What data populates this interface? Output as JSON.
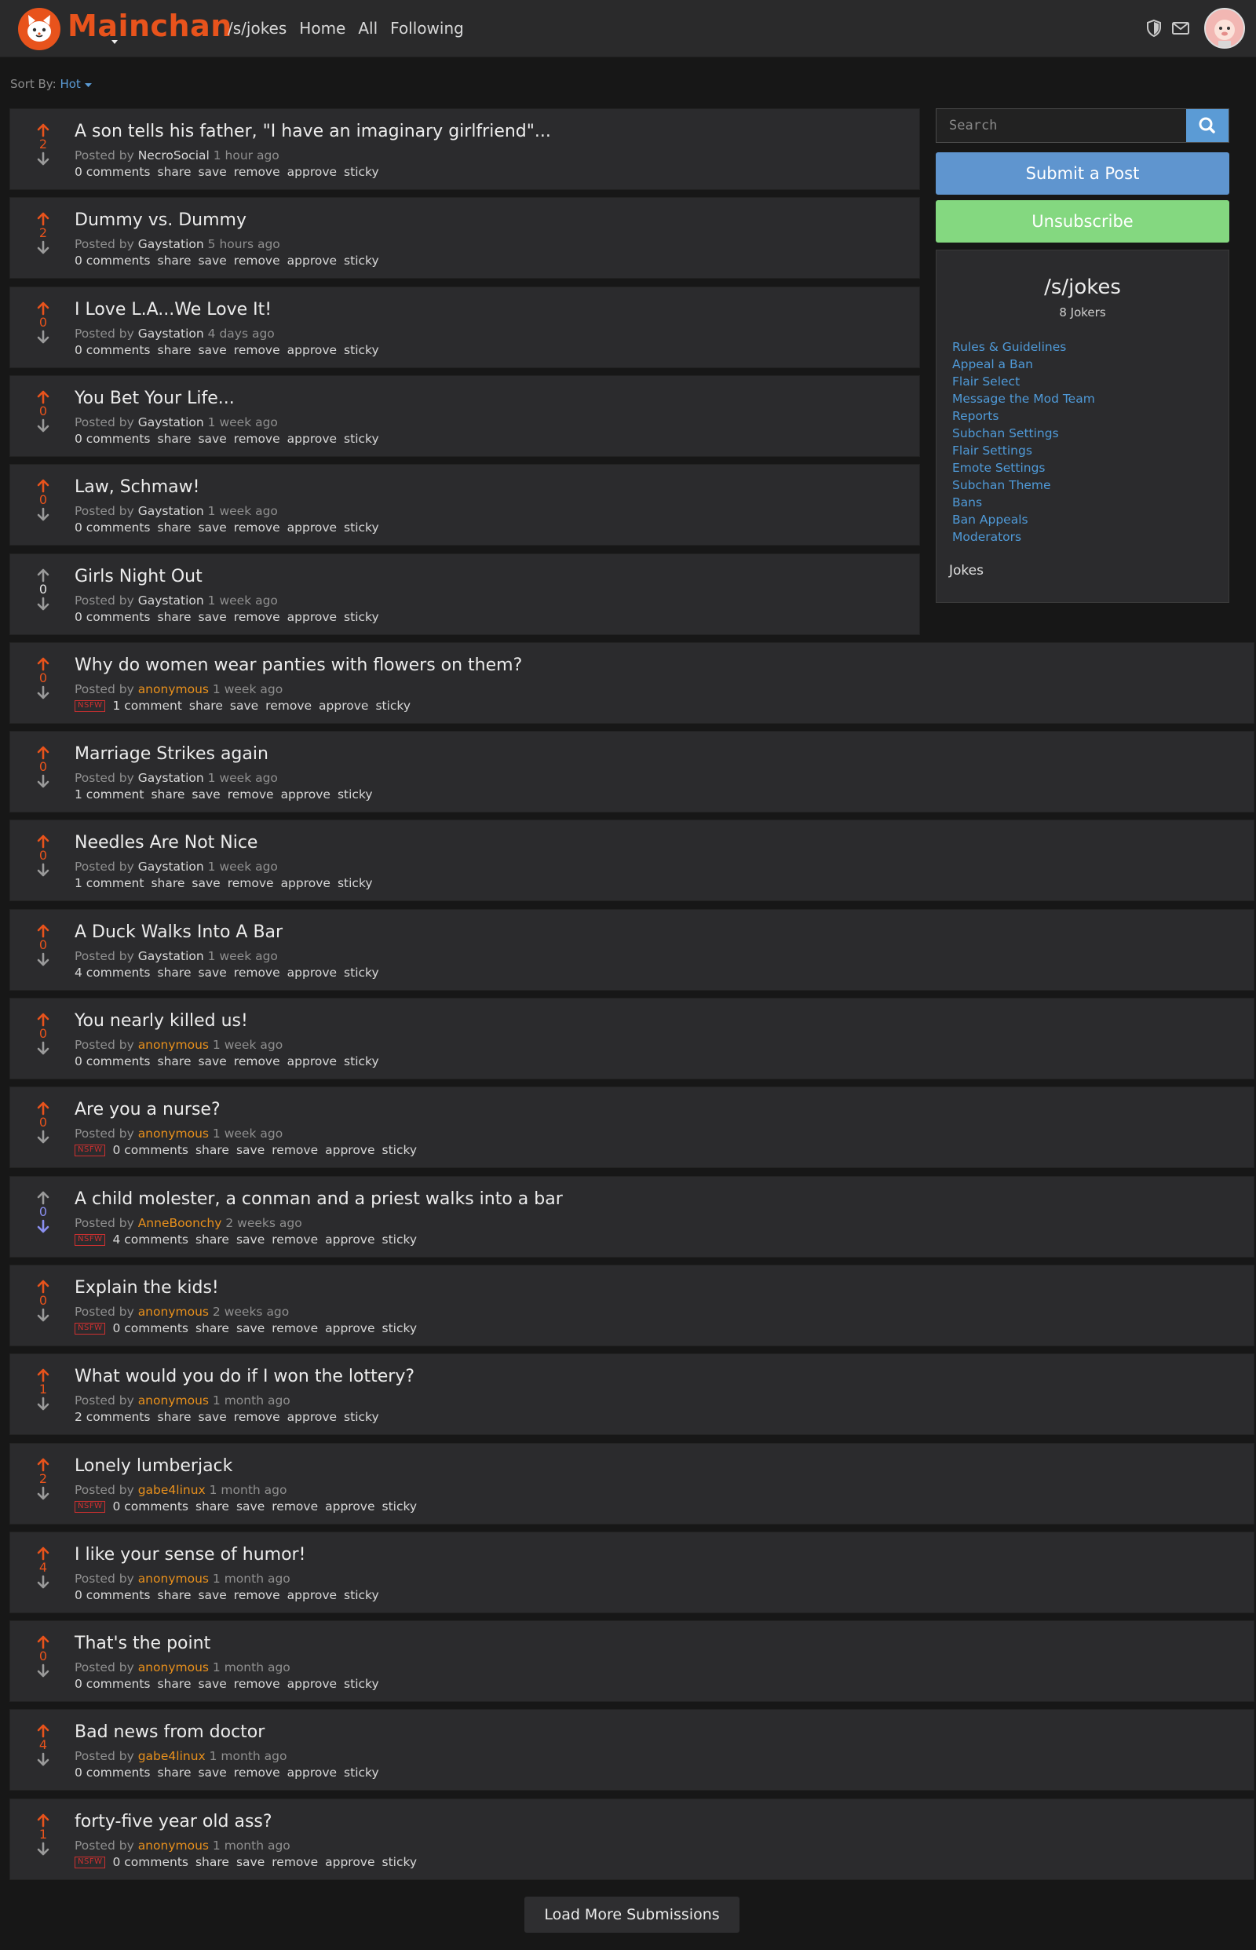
{
  "header": {
    "brand": "Mainchan",
    "nav": [
      "/s/jokes",
      "Home",
      "All",
      "Following"
    ]
  },
  "sort": {
    "label": "Sort By:",
    "value": "Hot"
  },
  "post_labels": {
    "posted_by": "Posted by",
    "actions": [
      "share",
      "save",
      "remove",
      "approve",
      "sticky"
    ],
    "nsfw": "NSFW"
  },
  "posts": [
    {
      "title": "A son tells his father, \"I have an imaginary girlfriend\"...",
      "author": "NecroSocial",
      "time": "1 hour ago",
      "score": "2",
      "comments": "0 comments",
      "nsfw": false,
      "anon": false,
      "vote": "up"
    },
    {
      "title": "Dummy vs. Dummy",
      "author": "Gaystation",
      "time": "5 hours ago",
      "score": "2",
      "comments": "0 comments",
      "nsfw": false,
      "anon": false,
      "vote": "up"
    },
    {
      "title": "I Love L.A...We Love It!",
      "author": "Gaystation",
      "time": "4 days ago",
      "score": "0",
      "comments": "0 comments",
      "nsfw": false,
      "anon": false,
      "vote": "up"
    },
    {
      "title": "You Bet Your Life...",
      "author": "Gaystation",
      "time": "1 week ago",
      "score": "0",
      "comments": "0 comments",
      "nsfw": false,
      "anon": false,
      "vote": "up"
    },
    {
      "title": "Law, Schmaw!",
      "author": "Gaystation",
      "time": "1 week ago",
      "score": "0",
      "comments": "0 comments",
      "nsfw": false,
      "anon": false,
      "vote": "up"
    },
    {
      "title": "Girls Night Out",
      "author": "Gaystation",
      "time": "1 week ago",
      "score": "0",
      "comments": "0 comments",
      "nsfw": false,
      "anon": false,
      "vote": "none"
    },
    {
      "title": "Why do women wear panties with flowers on them?",
      "author": "anonymous",
      "time": "1 week ago",
      "score": "0",
      "comments": "1 comment",
      "nsfw": true,
      "anon": true,
      "vote": "up"
    },
    {
      "title": "Marriage Strikes again",
      "author": "Gaystation",
      "time": "1 week ago",
      "score": "0",
      "comments": "1 comment",
      "nsfw": false,
      "anon": false,
      "vote": "up"
    },
    {
      "title": "Needles Are Not Nice",
      "author": "Gaystation",
      "time": "1 week ago",
      "score": "0",
      "comments": "1 comment",
      "nsfw": false,
      "anon": false,
      "vote": "up"
    },
    {
      "title": "A Duck Walks Into A Bar",
      "author": "Gaystation",
      "time": "1 week ago",
      "score": "0",
      "comments": "4 comments",
      "nsfw": false,
      "anon": false,
      "vote": "up"
    },
    {
      "title": "You nearly killed us!",
      "author": "anonymous",
      "time": "1 week ago",
      "score": "0",
      "comments": "0 comments",
      "nsfw": false,
      "anon": true,
      "vote": "up"
    },
    {
      "title": "Are you a nurse?",
      "author": "anonymous",
      "time": "1 week ago",
      "score": "0",
      "comments": "0 comments",
      "nsfw": true,
      "anon": true,
      "vote": "up"
    },
    {
      "title": "A child molester, a conman and a priest walks into a bar",
      "author": "AnneBoonchy",
      "time": "2 weeks ago",
      "score": "0",
      "comments": "4 comments",
      "nsfw": true,
      "anon": true,
      "vote": "down"
    },
    {
      "title": "Explain the kids!",
      "author": "anonymous",
      "time": "2 weeks ago",
      "score": "0",
      "comments": "0 comments",
      "nsfw": true,
      "anon": true,
      "vote": "up"
    },
    {
      "title": "What would you do if I won the lottery?",
      "author": "anonymous",
      "time": "1 month ago",
      "score": "1",
      "comments": "2 comments",
      "nsfw": false,
      "anon": true,
      "vote": "up"
    },
    {
      "title": "Lonely lumberjack",
      "author": "gabe4linux",
      "time": "1 month ago",
      "score": "2",
      "comments": "0 comments",
      "nsfw": true,
      "anon": true,
      "vote": "up"
    },
    {
      "title": "I like your sense of humor!",
      "author": "anonymous",
      "time": "1 month ago",
      "score": "4",
      "comments": "0 comments",
      "nsfw": false,
      "anon": true,
      "vote": "up"
    },
    {
      "title": "That's the point",
      "author": "anonymous",
      "time": "1 month ago",
      "score": "0",
      "comments": "0 comments",
      "nsfw": false,
      "anon": true,
      "vote": "up"
    },
    {
      "title": "Bad news from doctor",
      "author": "gabe4linux",
      "time": "1 month ago",
      "score": "4",
      "comments": "0 comments",
      "nsfw": false,
      "anon": true,
      "vote": "up"
    },
    {
      "title": "forty-five year old ass?",
      "author": "anonymous",
      "time": "1 month ago",
      "score": "1",
      "comments": "0 comments",
      "nsfw": true,
      "anon": true,
      "vote": "up"
    }
  ],
  "sidebar": {
    "search_placeholder": "Search",
    "submit_label": "Submit a Post",
    "unsubscribe_label": "Unsubscribe",
    "sub_title": "/s/jokes",
    "member_count": "8 Jokers",
    "links": [
      "Rules & Guidelines",
      "Appeal a Ban",
      "Flair Select",
      "Message the Mod Team",
      "Reports",
      "Subchan Settings",
      "Flair Settings",
      "Emote Settings",
      "Subchan Theme",
      "Bans",
      "Ban Appeals",
      "Moderators"
    ],
    "description": "Jokes"
  },
  "footer": {
    "load_more": "Load More Submissions"
  },
  "colors": {
    "brand": "#e8531c",
    "upvote": "#e8531c",
    "downvote": "#8a8ff0",
    "link": "#4f9ad8",
    "anon_author": "#e8901c",
    "submit_button": "#5f95cf",
    "unsubscribe_button": "#84d880",
    "nsfw": "#d03030"
  }
}
